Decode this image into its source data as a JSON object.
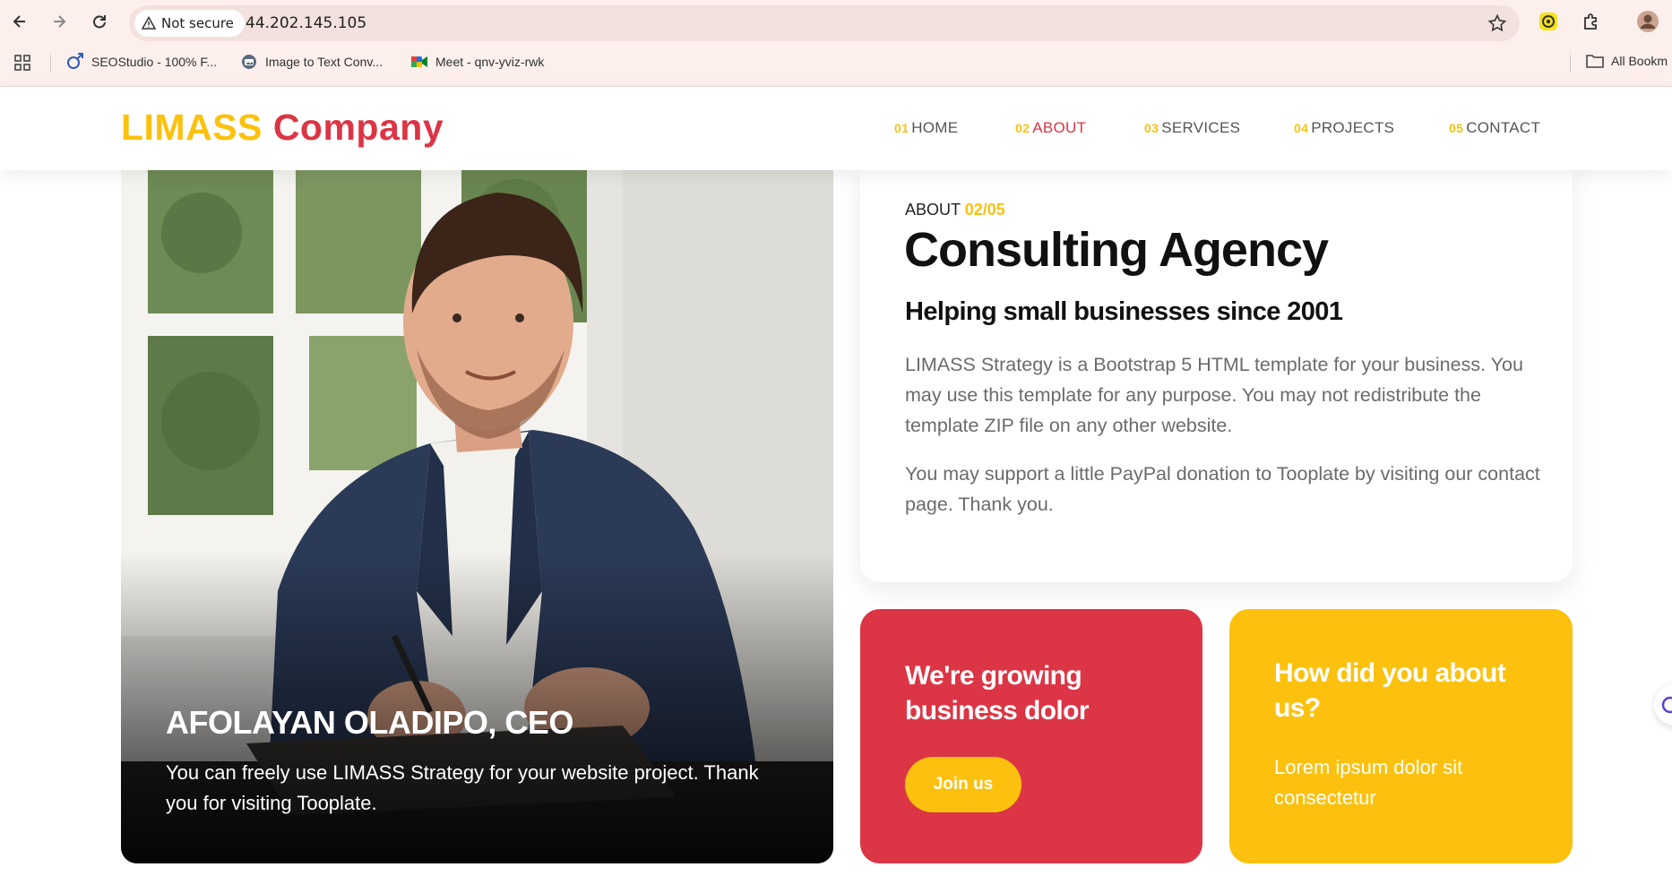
{
  "browser": {
    "security_label": "Not secure",
    "url": "44.202.145.105",
    "icons": [
      "back-icon",
      "forward-icon",
      "reload-icon",
      "warning-icon",
      "star-icon",
      "extension-icon",
      "puzzle-icon",
      "profile-icon"
    ],
    "bookmarks": [
      {
        "label": "SEOStudio - 100% F...",
        "icon": "seo-icon"
      },
      {
        "label": "Image to Text Conv...",
        "icon": "image-text-icon"
      },
      {
        "label": "Meet - qnv-yviz-rwk",
        "icon": "meet-icon"
      }
    ],
    "all_bookmarks": "All Bookm"
  },
  "site": {
    "logo_part1": "LIMASS",
    "logo_part2": "Company",
    "nav": [
      {
        "num": "01",
        "label": "HOME"
      },
      {
        "num": "02",
        "label": "ABOUT",
        "active": true
      },
      {
        "num": "03",
        "label": "SERVICES"
      },
      {
        "num": "04",
        "label": "PROJECTS"
      },
      {
        "num": "05",
        "label": "CONTACT"
      }
    ]
  },
  "hero": {
    "name": "AFOLAYAN OLADIPO, CEO",
    "text": "You can freely use LIMASS Strategy for your website project. Thank you for visiting Tooplate."
  },
  "about": {
    "label": "ABOUT",
    "page": "02/05",
    "title": "Consulting Agency",
    "subtitle": "Helping small businesses since 2001",
    "p1": "LIMASS Strategy is a Bootstrap 5 HTML template for your business. You may use this template for any purpose. You may not redistribute the template ZIP file on any other website.",
    "p2": "You may support a little PayPal donation to Tooplate by visiting our contact page. Thank you."
  },
  "cards": {
    "red_title": "We're growing business dolor",
    "join_button": "Join us",
    "yellow_title": "How did you about us?",
    "yellow_text": "Lorem ipsum dolor sit consectetur"
  },
  "colors": {
    "brand_yellow": "#fbc10e",
    "brand_red": "#dc3545",
    "chrome_bg": "#fcefec"
  }
}
